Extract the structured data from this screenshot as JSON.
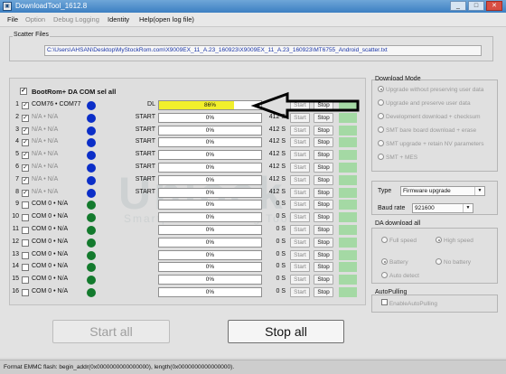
{
  "window": {
    "title": "DownloadTool_1612.8",
    "app_icon": "app-icon",
    "controls": [
      "_",
      "□",
      "✕"
    ]
  },
  "menu": {
    "items": [
      "File",
      "Option",
      "Debug Logging",
      "Identity",
      "Help(open log file)"
    ]
  },
  "scatter": {
    "label": "Scatter Files",
    "path": "C:\\Users\\AHSAN\\Desktop\\MyStockRom.com\\X9009EX_11_A.23_160923\\X9009EX_11_A.23_160923\\MT6755_Android_scatter.txt"
  },
  "bootrom": {
    "label": "BootRom+ DA COM sel all",
    "checked": true
  },
  "rows": [
    {
      "num": "1",
      "com": "COM76 • COM77",
      "stage": "DL",
      "progress": 0.86,
      "progress_text": "86%",
      "speed": "",
      "start": "Start",
      "stop": "Stop",
      "dot": "blue",
      "checked": true,
      "dim": false
    },
    {
      "num": "2",
      "com": "N/A • N/A",
      "stage": "START",
      "progress": 0,
      "progress_text": "0%",
      "speed": "412 S",
      "start": "Start",
      "stop": "Stop",
      "dot": "blue",
      "checked": true,
      "dim": true
    },
    {
      "num": "3",
      "com": "N/A • N/A",
      "stage": "START",
      "progress": 0,
      "progress_text": "0%",
      "speed": "412 S",
      "start": "Start",
      "stop": "Stop",
      "dot": "blue",
      "checked": true,
      "dim": true
    },
    {
      "num": "4",
      "com": "N/A • N/A",
      "stage": "START",
      "progress": 0,
      "progress_text": "0%",
      "speed": "412 S",
      "start": "Start",
      "stop": "Stop",
      "dot": "blue",
      "checked": true,
      "dim": true
    },
    {
      "num": "5",
      "com": "N/A • N/A",
      "stage": "START",
      "progress": 0,
      "progress_text": "0%",
      "speed": "412 S",
      "start": "Start",
      "stop": "Stop",
      "dot": "blue",
      "checked": true,
      "dim": true
    },
    {
      "num": "6",
      "com": "N/A • N/A",
      "stage": "START",
      "progress": 0,
      "progress_text": "0%",
      "speed": "412 S",
      "start": "Start",
      "stop": "Stop",
      "dot": "blue",
      "checked": true,
      "dim": true
    },
    {
      "num": "7",
      "com": "N/A • N/A",
      "stage": "START",
      "progress": 0,
      "progress_text": "0%",
      "speed": "412 S",
      "start": "Start",
      "stop": "Stop",
      "dot": "blue",
      "checked": true,
      "dim": true
    },
    {
      "num": "8",
      "com": "N/A • N/A",
      "stage": "START",
      "progress": 0,
      "progress_text": "0%",
      "speed": "412 S",
      "start": "Start",
      "stop": "Stop",
      "dot": "blue",
      "checked": true,
      "dim": true
    },
    {
      "num": "9",
      "com": "COM 0 • N/A",
      "stage": "",
      "progress": 0,
      "progress_text": "0%",
      "speed": "0 S",
      "start": "Start",
      "stop": "Stop",
      "dot": "green",
      "checked": false,
      "dim": false
    },
    {
      "num": "10",
      "com": "COM 0 • N/A",
      "stage": "",
      "progress": 0,
      "progress_text": "0%",
      "speed": "0 S",
      "start": "Start",
      "stop": "Stop",
      "dot": "green",
      "checked": false,
      "dim": false
    },
    {
      "num": "11",
      "com": "COM 0 • N/A",
      "stage": "",
      "progress": 0,
      "progress_text": "0%",
      "speed": "0 S",
      "start": "Start",
      "stop": "Stop",
      "dot": "green",
      "checked": false,
      "dim": false
    },
    {
      "num": "12",
      "com": "COM 0 • N/A",
      "stage": "",
      "progress": 0,
      "progress_text": "0%",
      "speed": "0 S",
      "start": "Start",
      "stop": "Stop",
      "dot": "green",
      "checked": false,
      "dim": false
    },
    {
      "num": "13",
      "com": "COM 0 • N/A",
      "stage": "",
      "progress": 0,
      "progress_text": "0%",
      "speed": "0 S",
      "start": "Start",
      "stop": "Stop",
      "dot": "green",
      "checked": false,
      "dim": false
    },
    {
      "num": "14",
      "com": "COM 0 • N/A",
      "stage": "",
      "progress": 0,
      "progress_text": "0%",
      "speed": "0 S",
      "start": "Start",
      "stop": "Stop",
      "dot": "green",
      "checked": false,
      "dim": false
    },
    {
      "num": "15",
      "com": "COM 0 • N/A",
      "stage": "",
      "progress": 0,
      "progress_text": "0%",
      "speed": "0 S",
      "start": "Start",
      "stop": "Stop",
      "dot": "green",
      "checked": false,
      "dim": false
    },
    {
      "num": "16",
      "com": "COM 0 • N/A",
      "stage": "",
      "progress": 0,
      "progress_text": "0%",
      "speed": "0 S",
      "start": "Start",
      "stop": "Stop",
      "dot": "green",
      "checked": false,
      "dim": false
    }
  ],
  "controls": {
    "start_all": "Start all",
    "stop_all": "Stop all"
  },
  "download_mode": {
    "title": "Download Mode",
    "options": [
      "Upgrade without preserving user data",
      "Upgrade and preserve user data",
      "Development download + checksum",
      "SMT bare board download + erase",
      "SMT upgrade + retain NV parameters",
      "SMT + MES"
    ],
    "selected": 0
  },
  "type_section": {
    "type_label": "Type",
    "type_value": "Firmware upgrade",
    "baud_label": "Baud rate",
    "baud_value": "921600"
  },
  "da_download": {
    "title": "DA download all",
    "speed_options": [
      "Full speed",
      "High speed"
    ],
    "speed_selected": 1,
    "battery_options": [
      "Battery",
      "No battery",
      "Auto detect"
    ],
    "battery_selected": 0
  },
  "auto_pulling": {
    "title": "AutoPulling",
    "option_label": "EnableAutoPulling"
  },
  "watermark": {
    "main": "Unlock",
    "sub": "Smartphone Flashing Tool"
  },
  "status_bar": {
    "text": "Format EMMC flash:  begin_addr(0x0000000000000000), length(0x0000000000000000)."
  },
  "colors": {
    "progress_yellow": "#f1ef2c",
    "dot_blue": "#0b2ec8",
    "dot_green": "#137a2d",
    "pass_box": "#a4d9a4"
  },
  "icons": {
    "app": "app-icon",
    "arrow": "left-arrow-annotation"
  }
}
